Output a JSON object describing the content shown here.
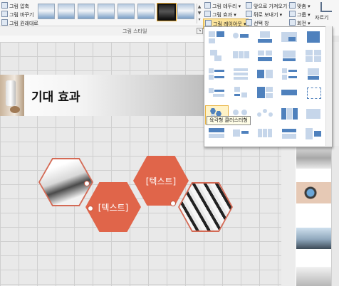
{
  "ribbon": {
    "adjust": {
      "compress_label": "그림 압축",
      "change_label": "그림 바꾸기",
      "reset_label": "그림 원래대로"
    },
    "styles_group_label": "그림 스타일",
    "picture_border_label": "그림 테두리",
    "picture_effects_label": "그림 효과",
    "picture_layout_label": "그림 레이아웃",
    "bring_forward_label": "앞으로 가져오기",
    "send_backward_label": "뒤로 보내기",
    "selection_pane_label": "선택 창",
    "align_label": "맞춤",
    "group_label": "그룹",
    "rotate_label": "회전",
    "crop_label": "자르기"
  },
  "layout_gallery": {
    "tooltip": "육각형 클러스터형"
  },
  "slide": {
    "title": "기대 효과",
    "text_1": "[텍스트]",
    "text_2": "[텍스트]"
  },
  "colors": {
    "accent_hexagon": "#e0654a",
    "smartart_blue": "#4f81bd"
  }
}
